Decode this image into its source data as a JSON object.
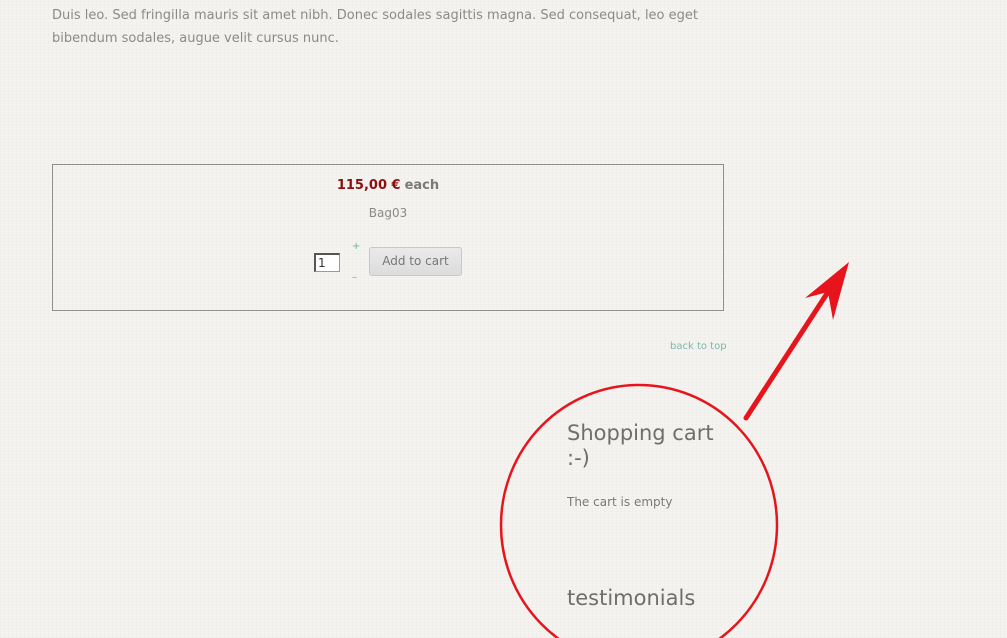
{
  "intro": {
    "text": "Duis leo. Sed fringilla mauris sit amet nibh. Donec sodales sagittis magna. Sed consequat, leo eget bibendum sodales, augue velit cursus nunc."
  },
  "product": {
    "price": "115,00 €",
    "price_unit": "each",
    "name": "Bag03",
    "quantity": "1",
    "plus_glyph": "+",
    "minus_glyph": "–",
    "add_to_cart_label": "Add to cart"
  },
  "back_to_top": "back to top",
  "sidebar": {
    "cart_title": "Shopping cart :-)",
    "cart_status": "The cart is empty",
    "testimonials_title": "testimonials"
  },
  "annotation": {
    "color": "#e8141b"
  }
}
